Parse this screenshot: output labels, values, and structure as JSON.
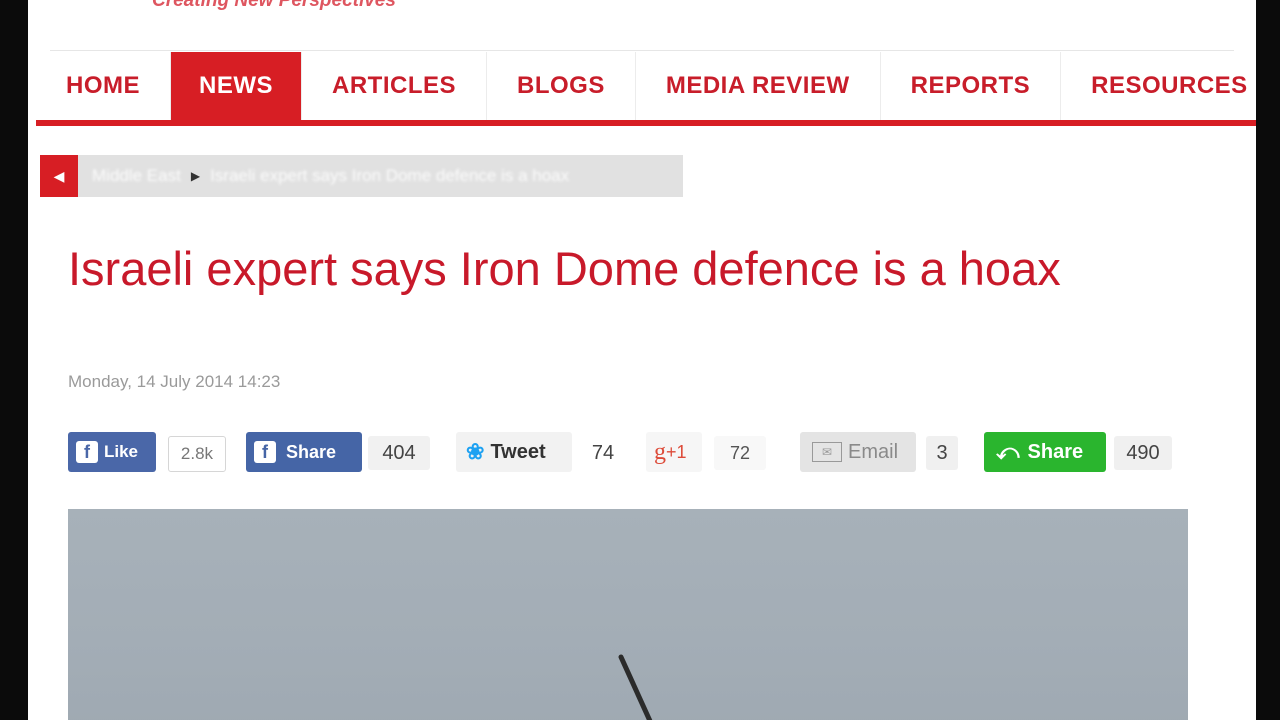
{
  "site": {
    "tagline": "Creating New Perspectives"
  },
  "nav": {
    "items": [
      {
        "label": "HOME"
      },
      {
        "label": "NEWS"
      },
      {
        "label": "ARTICLES"
      },
      {
        "label": "BLOGS"
      },
      {
        "label": "MEDIA REVIEW"
      },
      {
        "label": "REPORTS"
      },
      {
        "label": "RESOURCES"
      }
    ],
    "active": "NEWS"
  },
  "breadcrumb": {
    "home": "Middle East",
    "current": "Israeli expert says Iron Dome defence is a hoax"
  },
  "article": {
    "title": "Israeli expert says Iron Dome defence is a hoax",
    "date": "Monday, 14 July 2014 14:23"
  },
  "social": {
    "like_label": "Like",
    "like_count": "2.8k",
    "fb_share_label": "Share",
    "fb_share_count": "404",
    "tweet_label": "Tweet",
    "tweet_count": "74",
    "gplus_label": "+1",
    "gplus_count": "72",
    "email_label": "Email",
    "email_count": "3",
    "share_label": "Share",
    "share_count": "490"
  },
  "colors": {
    "brand_red": "#d71e24",
    "facebook": "#3b5998",
    "share_green": "#2ab52e"
  }
}
